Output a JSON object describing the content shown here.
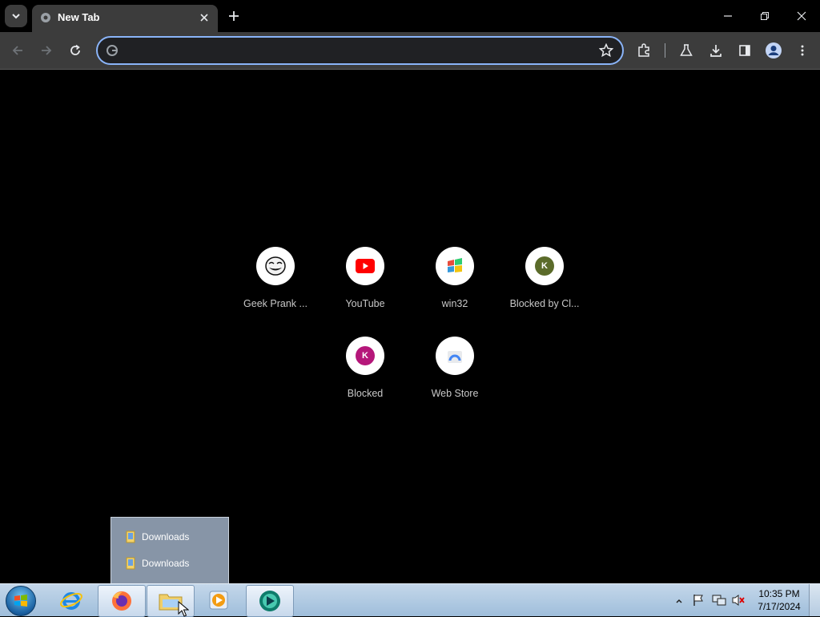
{
  "browser": {
    "tab": {
      "title": "New Tab"
    },
    "omnibox": {
      "value": "",
      "placeholder": ""
    }
  },
  "shortcuts": [
    {
      "label": "Geek Prank ...",
      "icon": "troll-face-icon"
    },
    {
      "label": "YouTube",
      "icon": "youtube-icon"
    },
    {
      "label": "win32",
      "icon": "windows-flag-icon"
    },
    {
      "label": "Blocked by Cl...",
      "icon": "letter-k-icon",
      "letter": "K",
      "color": "#5b6b2a"
    },
    {
      "label": "Blocked",
      "icon": "letter-k-icon",
      "letter": "K",
      "color": "#b5177a"
    },
    {
      "label": "Web Store",
      "icon": "web-store-icon"
    }
  ],
  "jumplist": {
    "items": [
      {
        "label": "Downloads"
      },
      {
        "label": "Downloads"
      }
    ]
  },
  "taskbar": {
    "clock": {
      "time": "10:35 PM",
      "date": "7/17/2024"
    }
  },
  "colors": {
    "accent": "#8ab4f8",
    "toolbar": "#3c3c3c",
    "background": "#000000"
  }
}
